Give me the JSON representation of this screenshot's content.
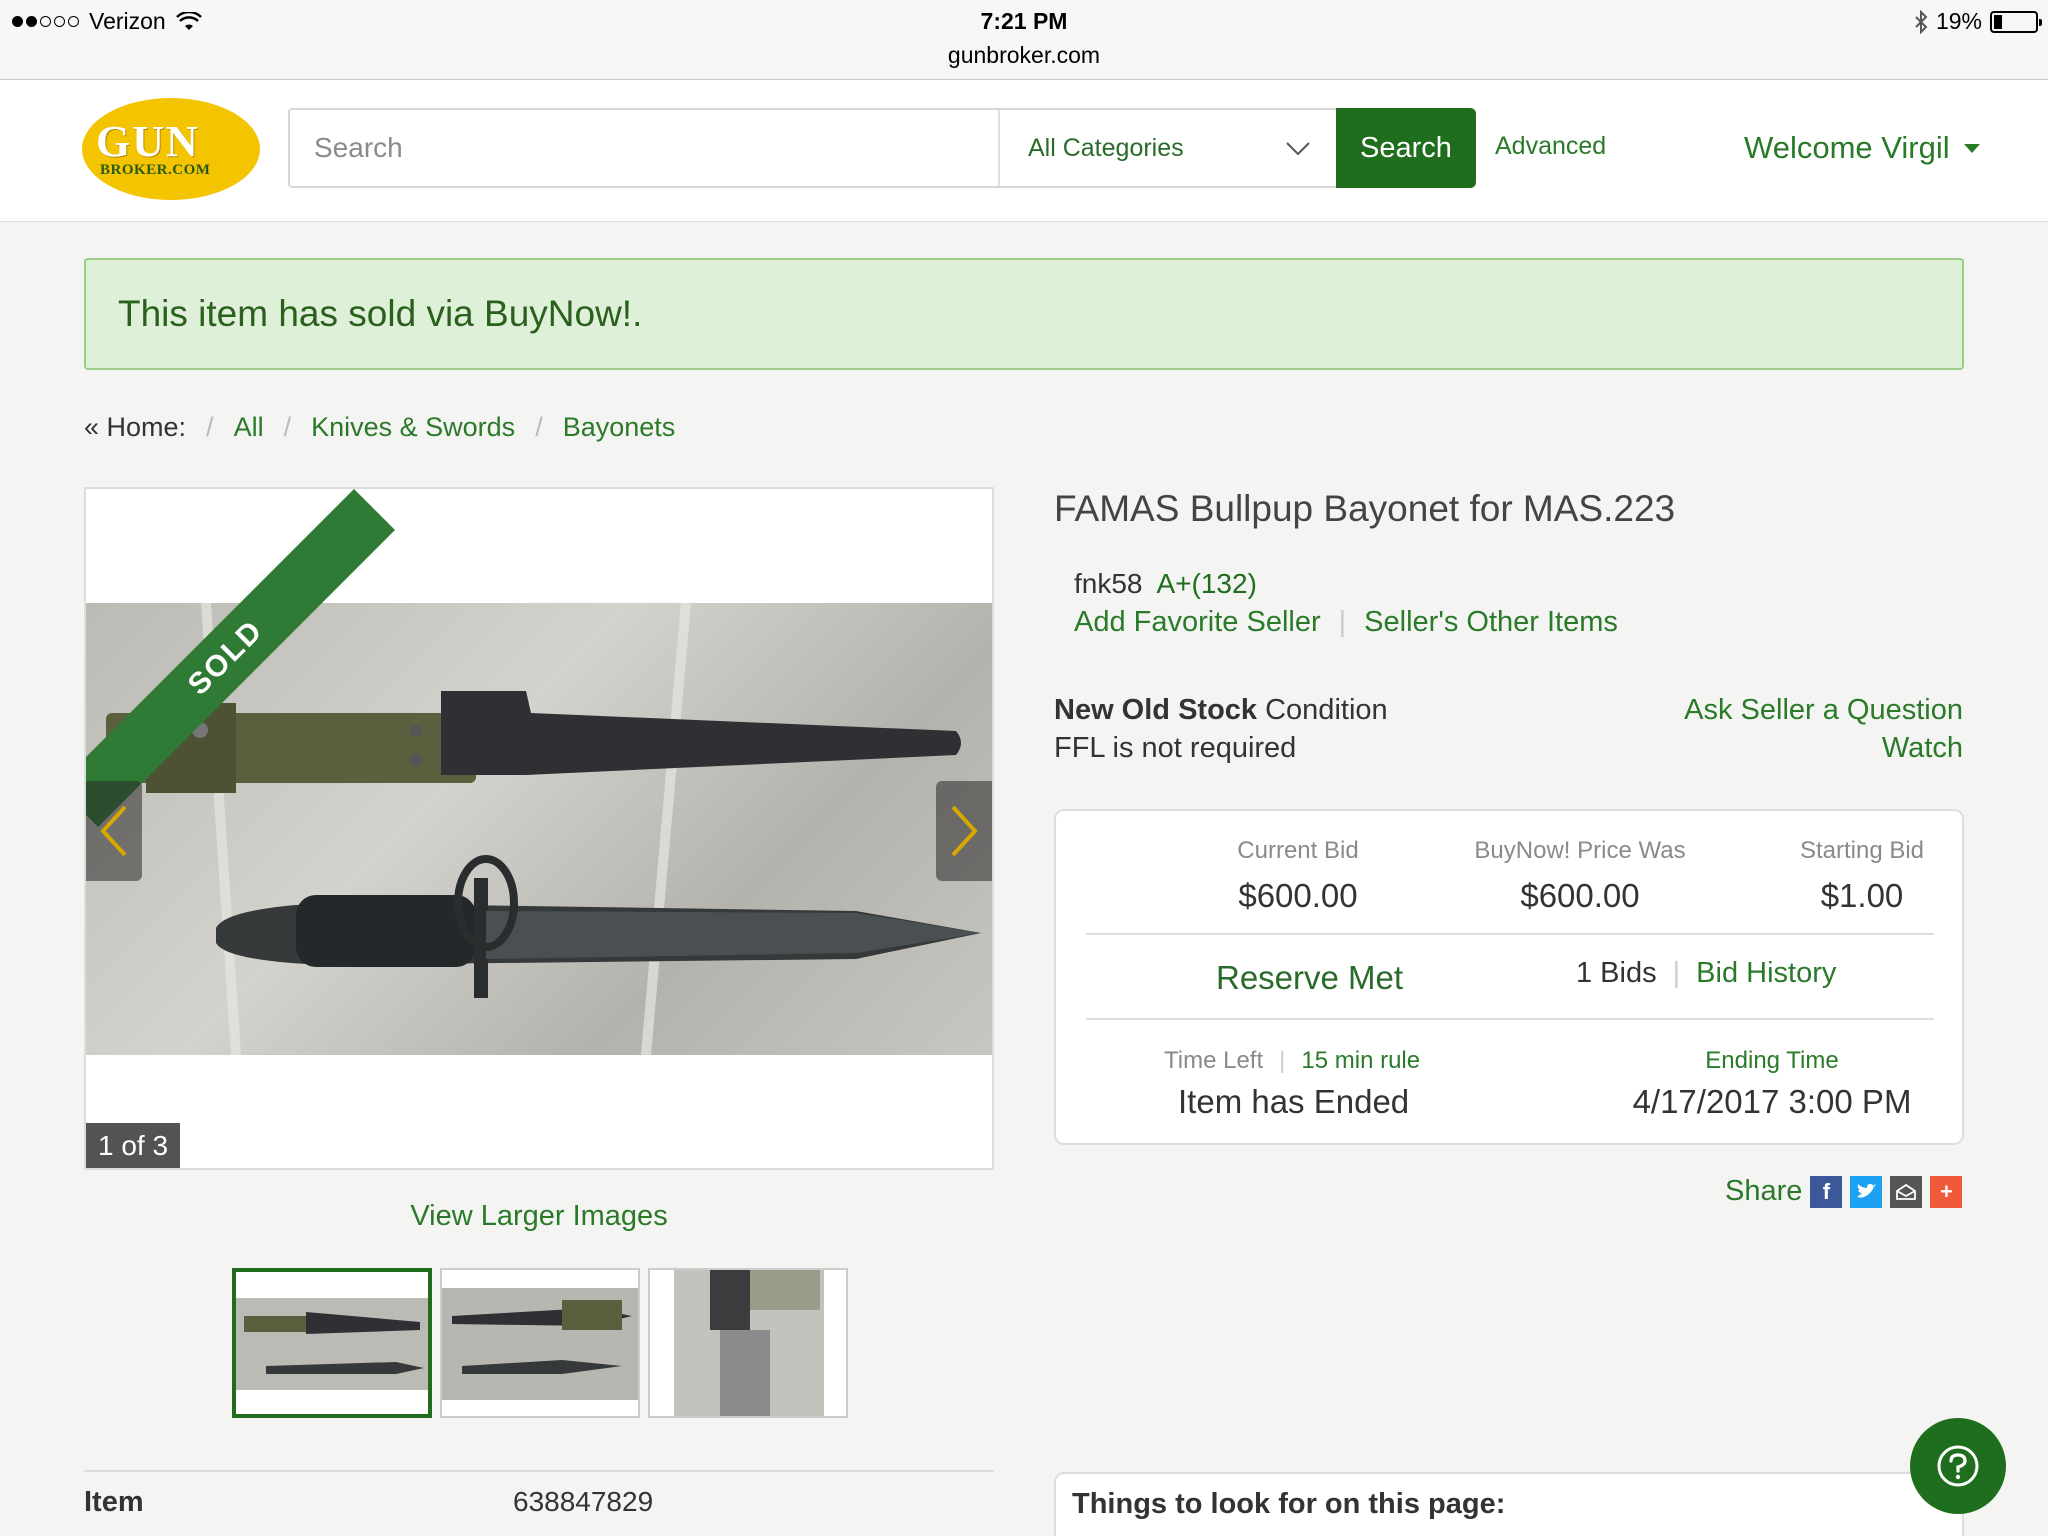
{
  "status_bar": {
    "carrier": "Verizon",
    "time": "7:21 PM",
    "url": "gunbroker.com",
    "battery": "19%",
    "battery_level": 0.19
  },
  "header": {
    "logo_top": "GUN",
    "logo_bottom": "BROKER.COM",
    "search_placeholder": "Search",
    "category": "All Categories",
    "search_button": "Search",
    "advanced": "Advanced",
    "welcome": "Welcome Virgil"
  },
  "banner": "This item has sold via BuyNow!.",
  "breadcrumb": {
    "home": "« Home:",
    "items": [
      "All",
      "Knives & Swords",
      "Bayonets"
    ]
  },
  "gallery": {
    "ribbon": "SOLD",
    "counter": "1 of 3",
    "view_larger": "View Larger Images"
  },
  "item": {
    "label": "Item",
    "number": "638847829"
  },
  "listing": {
    "title": "FAMAS Bullpup Bayonet for MAS.223",
    "seller_name": "fnk58",
    "seller_rating": "A+(132)",
    "add_favorite": "Add Favorite Seller",
    "other_items": "Seller's Other Items",
    "condition_value": "New Old Stock",
    "condition_label": "Condition",
    "ffl": "FFL is not required",
    "ask_question": "Ask Seller a Question",
    "watch": "Watch"
  },
  "bid_box": {
    "current_bid_label": "Current Bid",
    "current_bid": "$600.00",
    "buynow_label": "BuyNow! Price Was",
    "buynow": "$600.00",
    "starting_bid_label": "Starting Bid",
    "starting_bid": "$1.00",
    "reserve": "Reserve Met",
    "bids": "1 Bids",
    "bid_history": "Bid History",
    "time_left_label": "Time Left",
    "rule_link": "15 min rule",
    "time_left": "Item has Ended",
    "ending_label": "Ending Time",
    "ending": "4/17/2017 3:00 PM"
  },
  "share": {
    "label": "Share",
    "icons": [
      "facebook-icon",
      "twitter-icon",
      "email-icon",
      "plus-icon"
    ]
  },
  "things": "Things to look for on this page:",
  "colors": {
    "brand_green": "#1e6e1e",
    "link_green": "#2a7a2a",
    "banner_bg": "#dff0d8",
    "logo_yellow": "#f5c400"
  }
}
